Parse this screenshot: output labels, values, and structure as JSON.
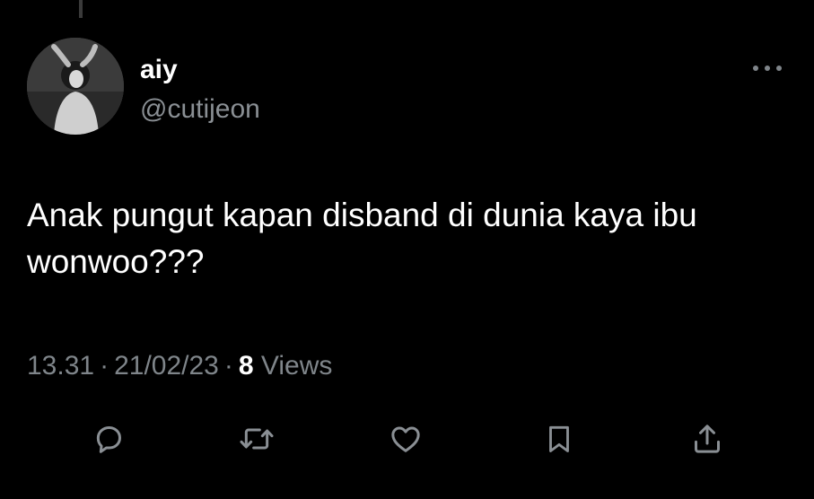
{
  "author": {
    "display_name": "aiy",
    "handle": "@cutijeon"
  },
  "tweet": {
    "text": "Anak pungut kapan disband di dunia kaya ibu wonwoo???"
  },
  "meta": {
    "time": "13.31",
    "separator": "·",
    "date": "21/02/23",
    "views_count": "8",
    "views_label": "Views"
  },
  "icons": {
    "more": "more-horizontal-icon",
    "reply": "reply-icon",
    "retweet": "retweet-icon",
    "like": "heart-icon",
    "bookmark": "bookmark-icon",
    "share": "share-icon"
  },
  "colors": {
    "background": "#000000",
    "text_primary": "#ffffff",
    "text_secondary": "#7f858a"
  }
}
